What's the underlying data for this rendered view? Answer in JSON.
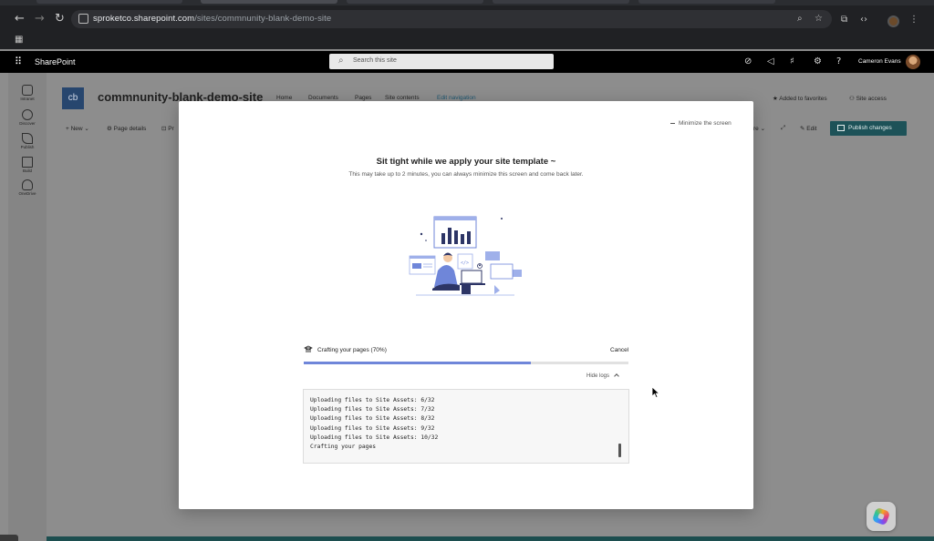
{
  "browser": {
    "url_host": "sproketco.sharepoint.com",
    "url_path": "/sites/commnunity-blank-demo-site"
  },
  "suite": {
    "brand": "SharePoint",
    "search_placeholder": "Search this site",
    "user_name": "Cameron Evans"
  },
  "rail": {
    "items": [
      {
        "label": "Intranet",
        "icon": "home-icon"
      },
      {
        "label": "Discover",
        "icon": "compass-icon"
      },
      {
        "label": "Publish",
        "icon": "pen-icon"
      },
      {
        "label": "Build",
        "icon": "build-icon"
      },
      {
        "label": "OneDrive",
        "icon": "cloud-icon"
      }
    ]
  },
  "site": {
    "logo_initials": "cb",
    "title": "commnunity-blank-demo-site",
    "nav": [
      "Home",
      "Documents",
      "Pages",
      "Site contents",
      "Edit navigation"
    ],
    "favorites": "Added to favorites",
    "access": "Site access"
  },
  "commandbar": {
    "new": "New",
    "page_details": "Page details",
    "partial_left": "Pr",
    "partial_right": "re",
    "edit": "Edit",
    "publish": "Publish changes"
  },
  "modal": {
    "minimize": "Minimize the screen",
    "title": "Sit tight while we apply your site template ~",
    "subtitle": "This may take up to 2 minutes, you can always minimize this screen and come back later.",
    "progress_label": "Crafting your pages (70%)",
    "progress_value": 0.7,
    "cancel": "Cancel",
    "hide_logs": "Hide logs",
    "logs": [
      "Uploading files to Site Assets: 6/32",
      "Uploading files to Site Assets: 7/32",
      "Uploading files to Site Assets: 8/32",
      "Uploading files to Site Assets: 9/32",
      "Uploading files to Site Assets: 10/32",
      "Crafting your pages"
    ]
  },
  "colors": {
    "accent_teal": "#1d5258",
    "progress_fill": "#6f86d9",
    "site_logo": "#27466e",
    "edit_nav_link": "#1e5670"
  }
}
